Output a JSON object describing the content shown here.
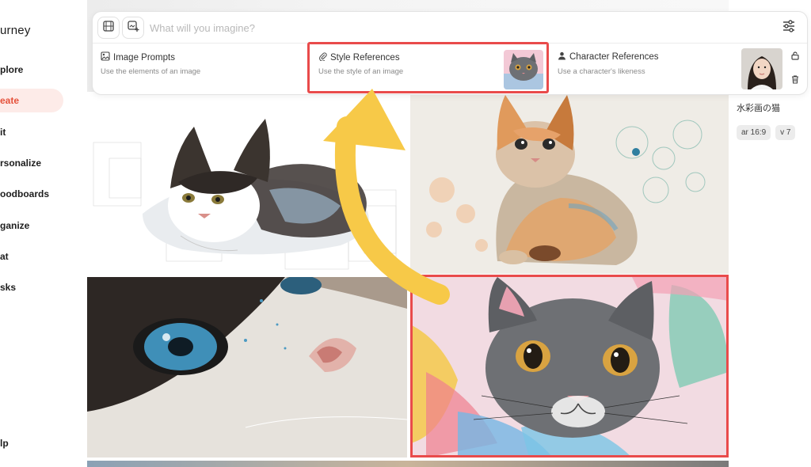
{
  "sidebar": {
    "brand": "urney",
    "items": [
      {
        "label": "plore",
        "active": false
      },
      {
        "label": "eate",
        "active": true
      },
      {
        "label": "it",
        "active": false
      },
      {
        "label": "rsonalize",
        "active": false
      },
      {
        "label": "oodboards",
        "active": false
      },
      {
        "label": "ganize",
        "active": false
      },
      {
        "label": "at",
        "active": false
      },
      {
        "label": "sks",
        "active": false
      }
    ],
    "help": "lp"
  },
  "prompt": {
    "placeholder": "What will you imagine?",
    "value": ""
  },
  "references": {
    "image": {
      "title": "Image Prompts",
      "subtitle": "Use the elements of an image",
      "icon": "image-icon"
    },
    "style": {
      "title": "Style References",
      "subtitle": "Use the style of an image",
      "icon": "paperclip-icon"
    },
    "character": {
      "title": "Character References",
      "subtitle": "Use a character's likeness",
      "icon": "person-icon"
    }
  },
  "details": {
    "title": "水彩画の猫",
    "chips": [
      "ar 16:9",
      "v 7"
    ]
  },
  "colors": {
    "accent": "#e5513a",
    "highlight": "#e94b4b",
    "arrow": "#f7c948"
  }
}
